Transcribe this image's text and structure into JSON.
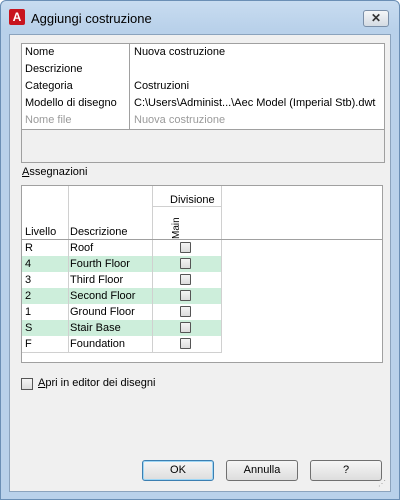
{
  "window": {
    "title": "Aggiungi costruzione",
    "close_glyph": "✕",
    "app_icon": "A"
  },
  "properties": [
    {
      "key": "Nome",
      "value": "Nuova costruzione",
      "disabled": false
    },
    {
      "key": "Descrizione",
      "value": "",
      "disabled": false
    },
    {
      "key": "Categoria",
      "value": "Costruzioni",
      "disabled": false
    },
    {
      "key": "Modello di disegno",
      "value": "C:\\Users\\Administ...\\Aec Model (Imperial Stb).dwt",
      "disabled": false
    },
    {
      "key": "Nome file",
      "value": "Nuova costruzione",
      "disabled": true
    }
  ],
  "assignments": {
    "label_underlined": "A",
    "label_rest": "ssegnazioni",
    "headers": {
      "level": "Livello",
      "description": "Descrizione",
      "division": "Divisione",
      "division_column": "Main"
    },
    "rows": [
      {
        "level": "R",
        "description": "Roof",
        "checked": false
      },
      {
        "level": "4",
        "description": "Fourth Floor",
        "checked": false
      },
      {
        "level": "3",
        "description": "Third Floor",
        "checked": false
      },
      {
        "level": "2",
        "description": "Second Floor",
        "checked": false
      },
      {
        "level": "1",
        "description": "Ground Floor",
        "checked": false
      },
      {
        "level": "S",
        "description": "Stair Base",
        "checked": false
      },
      {
        "level": "F",
        "description": "Foundation",
        "checked": false
      }
    ]
  },
  "open_editor": {
    "label_underlined": "A",
    "label_rest": "pri in editor dei disegni",
    "checked": false
  },
  "buttons": {
    "ok": "OK",
    "cancel": "Annulla",
    "help": "?"
  },
  "colors": {
    "alt_row": "#cdeedb",
    "title_bar": "#b9d1ea",
    "app_icon": "#c8141e"
  }
}
